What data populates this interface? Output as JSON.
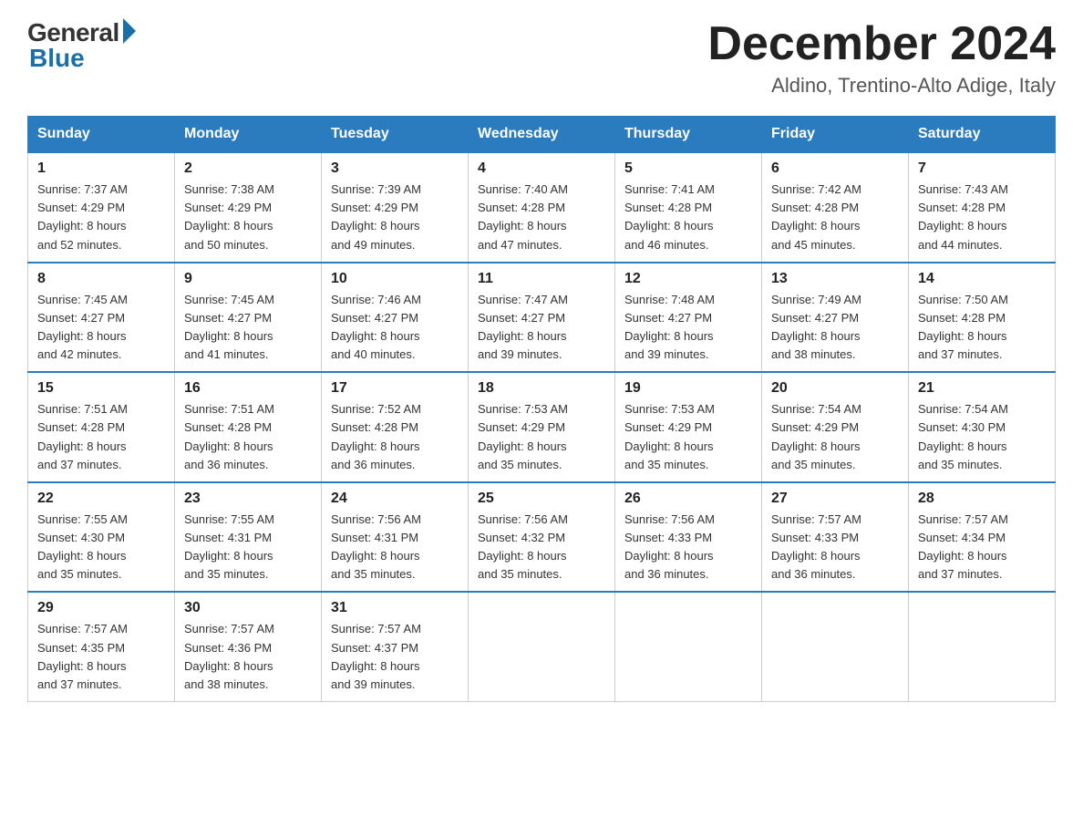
{
  "header": {
    "logo_general": "General",
    "logo_blue": "Blue",
    "month_title": "December 2024",
    "location": "Aldino, Trentino-Alto Adige, Italy"
  },
  "weekdays": [
    "Sunday",
    "Monday",
    "Tuesday",
    "Wednesday",
    "Thursday",
    "Friday",
    "Saturday"
  ],
  "weeks": [
    [
      {
        "day": "1",
        "sunrise": "7:37 AM",
        "sunset": "4:29 PM",
        "daylight": "8 hours and 52 minutes."
      },
      {
        "day": "2",
        "sunrise": "7:38 AM",
        "sunset": "4:29 PM",
        "daylight": "8 hours and 50 minutes."
      },
      {
        "day": "3",
        "sunrise": "7:39 AM",
        "sunset": "4:29 PM",
        "daylight": "8 hours and 49 minutes."
      },
      {
        "day": "4",
        "sunrise": "7:40 AM",
        "sunset": "4:28 PM",
        "daylight": "8 hours and 47 minutes."
      },
      {
        "day": "5",
        "sunrise": "7:41 AM",
        "sunset": "4:28 PM",
        "daylight": "8 hours and 46 minutes."
      },
      {
        "day": "6",
        "sunrise": "7:42 AM",
        "sunset": "4:28 PM",
        "daylight": "8 hours and 45 minutes."
      },
      {
        "day": "7",
        "sunrise": "7:43 AM",
        "sunset": "4:28 PM",
        "daylight": "8 hours and 44 minutes."
      }
    ],
    [
      {
        "day": "8",
        "sunrise": "7:45 AM",
        "sunset": "4:27 PM",
        "daylight": "8 hours and 42 minutes."
      },
      {
        "day": "9",
        "sunrise": "7:45 AM",
        "sunset": "4:27 PM",
        "daylight": "8 hours and 41 minutes."
      },
      {
        "day": "10",
        "sunrise": "7:46 AM",
        "sunset": "4:27 PM",
        "daylight": "8 hours and 40 minutes."
      },
      {
        "day": "11",
        "sunrise": "7:47 AM",
        "sunset": "4:27 PM",
        "daylight": "8 hours and 39 minutes."
      },
      {
        "day": "12",
        "sunrise": "7:48 AM",
        "sunset": "4:27 PM",
        "daylight": "8 hours and 39 minutes."
      },
      {
        "day": "13",
        "sunrise": "7:49 AM",
        "sunset": "4:27 PM",
        "daylight": "8 hours and 38 minutes."
      },
      {
        "day": "14",
        "sunrise": "7:50 AM",
        "sunset": "4:28 PM",
        "daylight": "8 hours and 37 minutes."
      }
    ],
    [
      {
        "day": "15",
        "sunrise": "7:51 AM",
        "sunset": "4:28 PM",
        "daylight": "8 hours and 37 minutes."
      },
      {
        "day": "16",
        "sunrise": "7:51 AM",
        "sunset": "4:28 PM",
        "daylight": "8 hours and 36 minutes."
      },
      {
        "day": "17",
        "sunrise": "7:52 AM",
        "sunset": "4:28 PM",
        "daylight": "8 hours and 36 minutes."
      },
      {
        "day": "18",
        "sunrise": "7:53 AM",
        "sunset": "4:29 PM",
        "daylight": "8 hours and 35 minutes."
      },
      {
        "day": "19",
        "sunrise": "7:53 AM",
        "sunset": "4:29 PM",
        "daylight": "8 hours and 35 minutes."
      },
      {
        "day": "20",
        "sunrise": "7:54 AM",
        "sunset": "4:29 PM",
        "daylight": "8 hours and 35 minutes."
      },
      {
        "day": "21",
        "sunrise": "7:54 AM",
        "sunset": "4:30 PM",
        "daylight": "8 hours and 35 minutes."
      }
    ],
    [
      {
        "day": "22",
        "sunrise": "7:55 AM",
        "sunset": "4:30 PM",
        "daylight": "8 hours and 35 minutes."
      },
      {
        "day": "23",
        "sunrise": "7:55 AM",
        "sunset": "4:31 PM",
        "daylight": "8 hours and 35 minutes."
      },
      {
        "day": "24",
        "sunrise": "7:56 AM",
        "sunset": "4:31 PM",
        "daylight": "8 hours and 35 minutes."
      },
      {
        "day": "25",
        "sunrise": "7:56 AM",
        "sunset": "4:32 PM",
        "daylight": "8 hours and 35 minutes."
      },
      {
        "day": "26",
        "sunrise": "7:56 AM",
        "sunset": "4:33 PM",
        "daylight": "8 hours and 36 minutes."
      },
      {
        "day": "27",
        "sunrise": "7:57 AM",
        "sunset": "4:33 PM",
        "daylight": "8 hours and 36 minutes."
      },
      {
        "day": "28",
        "sunrise": "7:57 AM",
        "sunset": "4:34 PM",
        "daylight": "8 hours and 37 minutes."
      }
    ],
    [
      {
        "day": "29",
        "sunrise": "7:57 AM",
        "sunset": "4:35 PM",
        "daylight": "8 hours and 37 minutes."
      },
      {
        "day": "30",
        "sunrise": "7:57 AM",
        "sunset": "4:36 PM",
        "daylight": "8 hours and 38 minutes."
      },
      {
        "day": "31",
        "sunrise": "7:57 AM",
        "sunset": "4:37 PM",
        "daylight": "8 hours and 39 minutes."
      },
      null,
      null,
      null,
      null
    ]
  ],
  "labels": {
    "sunrise": "Sunrise:",
    "sunset": "Sunset:",
    "daylight": "Daylight:"
  }
}
